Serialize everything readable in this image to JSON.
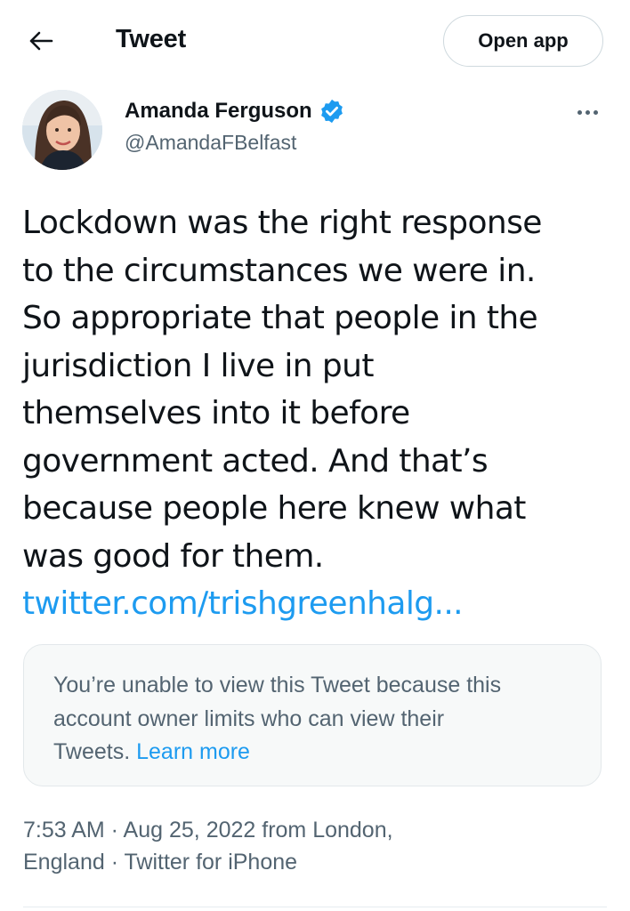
{
  "header": {
    "title": "Tweet",
    "back_icon": "arrow-left-icon",
    "open_app_label": "Open app"
  },
  "author": {
    "name": "Amanda Ferguson",
    "handle": "@AmandaFBelfast",
    "verified": true,
    "verified_icon": "verified-badge-icon",
    "more_icon": "more-horizontal-icon"
  },
  "tweet": {
    "lines": [
      "Lockdown was the right response",
      "to the circumstances we were in.",
      "So appropriate that people in the",
      "jurisdiction I live in put",
      "themselves into it before",
      "government acted. And that’s",
      "because people here knew what",
      "was good for them."
    ],
    "link": "twitter.com/trishgreenhalg..."
  },
  "quote_unavailable": {
    "lines": [
      "You’re unable to view this Tweet because this",
      "account owner limits who can view their",
      "Tweets."
    ],
    "learn_more": "Learn more"
  },
  "meta": {
    "line1": "7:53 AM · Aug 25, 2022 from London,",
    "line2": "England · Twitter for iPhone"
  },
  "colors": {
    "accent": "#1d9bf0",
    "text_primary": "#0f1419",
    "text_secondary": "#536471",
    "card_bg": "#f7f9f9",
    "border": "#cfd9de"
  }
}
